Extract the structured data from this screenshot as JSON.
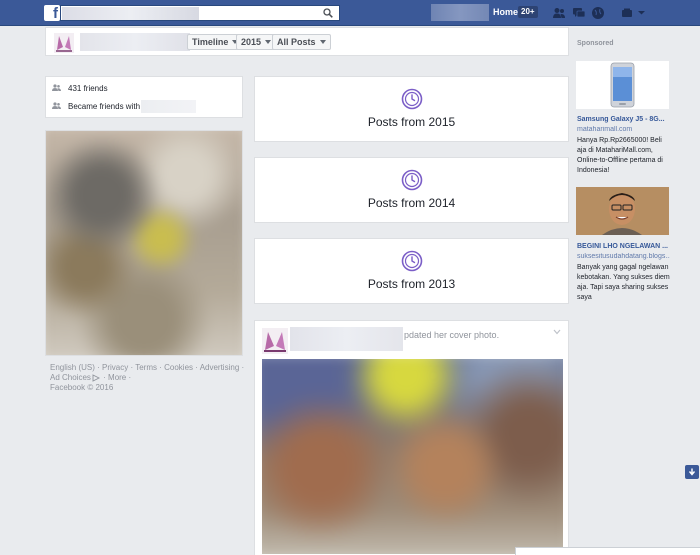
{
  "topbar": {
    "home_label": "Home",
    "home_count": "20+",
    "search_placeholder": ""
  },
  "timeline_bar": {
    "timeline_label": "Timeline",
    "year_label": "2015",
    "filter_label": "All Posts"
  },
  "left_info": {
    "friends": "431 friends",
    "became_friends": "Became friends with"
  },
  "footer": {
    "english": "English (US)",
    "privacy": "Privacy",
    "terms": "Terms",
    "cookies": "Cookies",
    "advertising": "Advertising",
    "ad_choices": "Ad Choices",
    "more": "More",
    "copyright": "Facebook © 2016"
  },
  "posts": [
    {
      "label": "Posts from 2015"
    },
    {
      "label": "Posts from 2014"
    },
    {
      "label": "Posts from 2013"
    }
  ],
  "cover_post": {
    "text": "pdated her cover photo."
  },
  "sidebar": {
    "sponsored": "Sponsored",
    "ads": [
      {
        "title": "Samsung Galaxy J5 - 8G...",
        "url": "mataharimall.com",
        "desc": "Hanya Rp.Rp2665000! Beli aja di MatahariMall.com, Online-to-Offline pertama di Indonesia!"
      },
      {
        "title": "BEGINI LHO NGELAWAN ...",
        "url": "suksesitusudahdatang.blogs...",
        "desc": "Banyak yang gagal ngelawan kebotakan. Yang sukses diem aja. Tapi saya sharing sukses saya"
      }
    ]
  },
  "colors": {
    "brand": "#3b5998",
    "link": "#365899",
    "accent_purple": "#7b5ec7"
  }
}
